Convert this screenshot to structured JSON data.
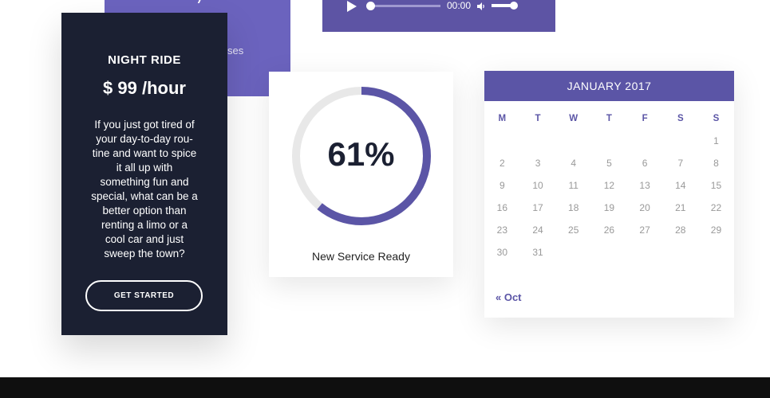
{
  "background_card": {
    "partial_text": "ses"
  },
  "audio_player": {
    "time": "00:00",
    "progress": 0,
    "volume": 0.8
  },
  "night_ride": {
    "title": "NIGHT RIDE",
    "price": "$ 99 /hour",
    "description": "If you just got tired of your day-to-day rou-tine and want to spice it all up with something fun and special, what can be a better option than renting a limo or a cool car and just sweep the town?",
    "button_label": "GET STARTED"
  },
  "progress_card": {
    "percent": 61,
    "value_label": "61%",
    "caption": "New Service Ready",
    "colors": {
      "track": "#e8e8e8",
      "bar": "#5b55a6"
    }
  },
  "calendar": {
    "title": "JANUARY 2017",
    "weekdays": [
      "M",
      "T",
      "W",
      "T",
      "F",
      "S",
      "S"
    ],
    "weeks": [
      [
        "",
        "",
        "",
        "",
        "",
        "",
        "1"
      ],
      [
        "2",
        "3",
        "4",
        "5",
        "6",
        "7",
        "8"
      ],
      [
        "9",
        "10",
        "11",
        "12",
        "13",
        "14",
        "15"
      ],
      [
        "16",
        "17",
        "18",
        "19",
        "20",
        "21",
        "22"
      ],
      [
        "23",
        "24",
        "25",
        "26",
        "27",
        "28",
        "29"
      ],
      [
        "30",
        "31",
        "",
        "",
        "",
        "",
        ""
      ]
    ],
    "prev_link": "« Oct"
  }
}
